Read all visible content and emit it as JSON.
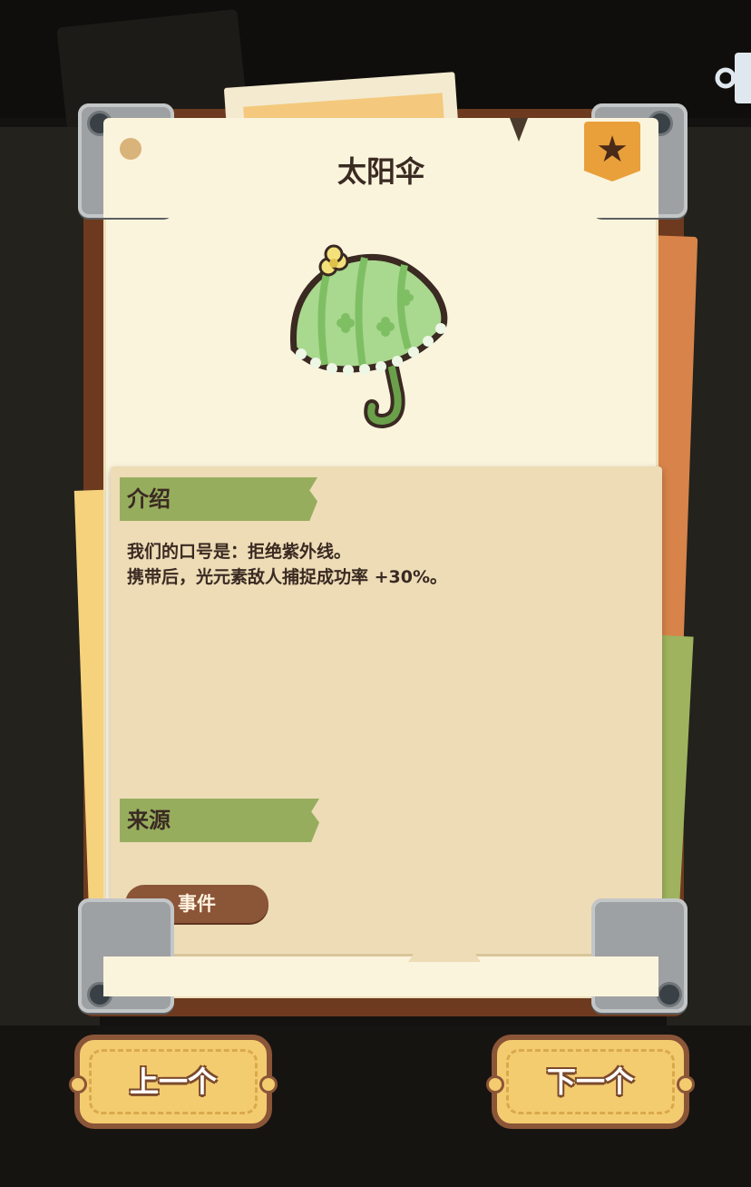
{
  "item": {
    "name": "太阳伞",
    "favorite_icon": "star-icon"
  },
  "sections": {
    "intro_label": "介绍",
    "intro_lines": [
      "我们的口号是：拒绝紫外线。",
      "携带后，光元素敌人捕捉成功率 +30%。"
    ],
    "source_label": "来源",
    "source_button": "事件"
  },
  "nav": {
    "prev_label": "上一个",
    "next_label": "下一个"
  },
  "colors": {
    "paper": "#fbf4dc",
    "panel": "#eddcb6",
    "ribbon": "#97ad5e",
    "button_brown": "#8b5538",
    "nav_yellow": "#f4cc70",
    "star_badge": "#e9a03b"
  },
  "icons": {
    "top_right": "share-icon",
    "illustration": "umbrella-icon"
  }
}
